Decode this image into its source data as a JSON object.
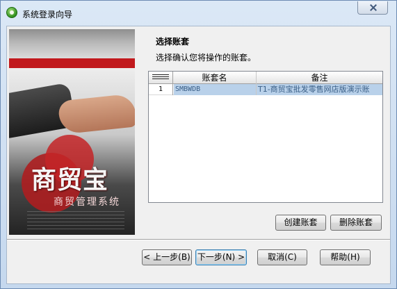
{
  "window": {
    "title": "系统登录向导"
  },
  "banner": {
    "logo_text": "商贸宝",
    "subtitle": "商贸管理系统"
  },
  "header": {
    "title": "选择账套",
    "subtitle": "选择确认您将操作的账套。"
  },
  "grid": {
    "columns": [
      "账套名",
      "备注"
    ],
    "rows": [
      {
        "num": "1",
        "name": "SMBWDB",
        "remark": "T1-商贸宝批发零售网店版演示账"
      }
    ]
  },
  "buttons": {
    "create": "创建账套",
    "delete": "删除账套",
    "prev": "< 上一步(B)",
    "next": "下一步(N) >",
    "cancel": "取消(C)",
    "help": "帮助(H)"
  },
  "colors": {
    "selection": "#b9d1ea",
    "brand_red": "#c1191d"
  }
}
